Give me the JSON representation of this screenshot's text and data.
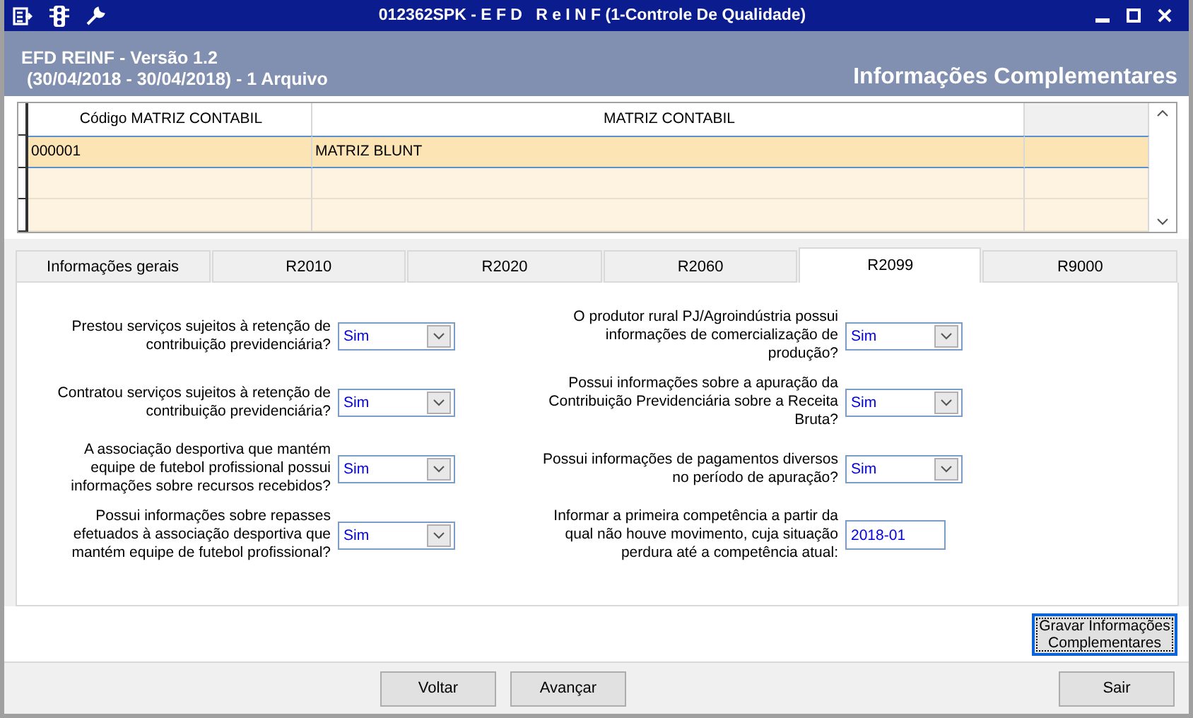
{
  "window": {
    "title": "012362SPK - E F D   R e I N F (1-Controle De Qualidade)"
  },
  "header": {
    "app": "EFD REINF - Versão 1.2",
    "period": "(30/04/2018 - 30/04/2018) - 1 Arquivo",
    "section": "Informações Complementares"
  },
  "grid": {
    "columns": [
      "Código MATRIZ CONTABIL",
      "MATRIZ CONTABIL"
    ],
    "rows": [
      {
        "cells": [
          "000001",
          "MATRIZ BLUNT"
        ],
        "selected": true
      }
    ]
  },
  "tabs": [
    {
      "label": "Informações gerais",
      "selected": false
    },
    {
      "label": "R2010",
      "selected": false
    },
    {
      "label": "R2020",
      "selected": false
    },
    {
      "label": "R2060",
      "selected": false
    },
    {
      "label": "R2099",
      "selected": true
    },
    {
      "label": "R9000",
      "selected": false
    }
  ],
  "left_fields": [
    {
      "label": "Prestou serviços sujeitos à retenção de contribuição previdenciária?",
      "kind": "select",
      "value": "Sim"
    },
    {
      "label": "Contratou serviços sujeitos à retenção de contribuição previdenciária?",
      "kind": "select",
      "value": "Sim"
    },
    {
      "label": "A associação desportiva que mantém equipe de futebol profissional possui informações sobre recursos recebidos?",
      "kind": "select",
      "value": "Sim"
    },
    {
      "label": "Possui informações sobre repasses efetuados à associação desportiva que mantém equipe de futebol profissional?",
      "kind": "select",
      "value": "Sim"
    }
  ],
  "right_fields": [
    {
      "label": "O produtor rural PJ/Agroindústria possui informações de comercialização de produção?",
      "kind": "select",
      "value": "Sim"
    },
    {
      "label": "Possui informações sobre a apuração da Contribuição Previdenciária sobre a Receita Bruta?",
      "kind": "select",
      "value": "Sim"
    },
    {
      "label": "Possui informações de pagamentos diversos no período de apuração?",
      "kind": "select",
      "value": "Sim"
    },
    {
      "label": "Informar a primeira competência a partir da qual não houve movimento, cuja situação perdura até a competência atual:",
      "kind": "text",
      "value": "2018-01"
    }
  ],
  "save_button": {
    "label": "Gravar Informações Complementares",
    "focused": true
  },
  "footer_buttons": [
    {
      "label": "Voltar",
      "kind": "nav"
    },
    {
      "label": "Avançar",
      "kind": "nav"
    },
    {
      "label": "Sair",
      "kind": "exit"
    }
  ]
}
